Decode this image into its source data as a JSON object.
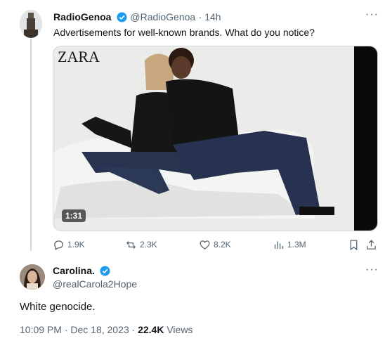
{
  "tweet1": {
    "display_name": "RadioGenoa",
    "handle": "@RadioGenoa",
    "time": "· 14h",
    "text": "Advertisements for well-known brands. What do you notice?",
    "video": {
      "brand_mark": "ZARA",
      "duration": "1:31"
    },
    "actions": {
      "replies": "1.9K",
      "reposts": "2.3K",
      "likes": "8.2K",
      "views": "1.3M"
    }
  },
  "tweet2": {
    "display_name": "Carolina.",
    "handle": "@realCarola2Hope",
    "text": "White genocide.",
    "time": "10:09 PM · Dec 18, 2023 · ",
    "views_count": "22.4K",
    "views_label": " Views"
  },
  "colors": {
    "verified": "#1d9bf0",
    "muted": "#536471",
    "thread_line": "#cfd9de"
  }
}
